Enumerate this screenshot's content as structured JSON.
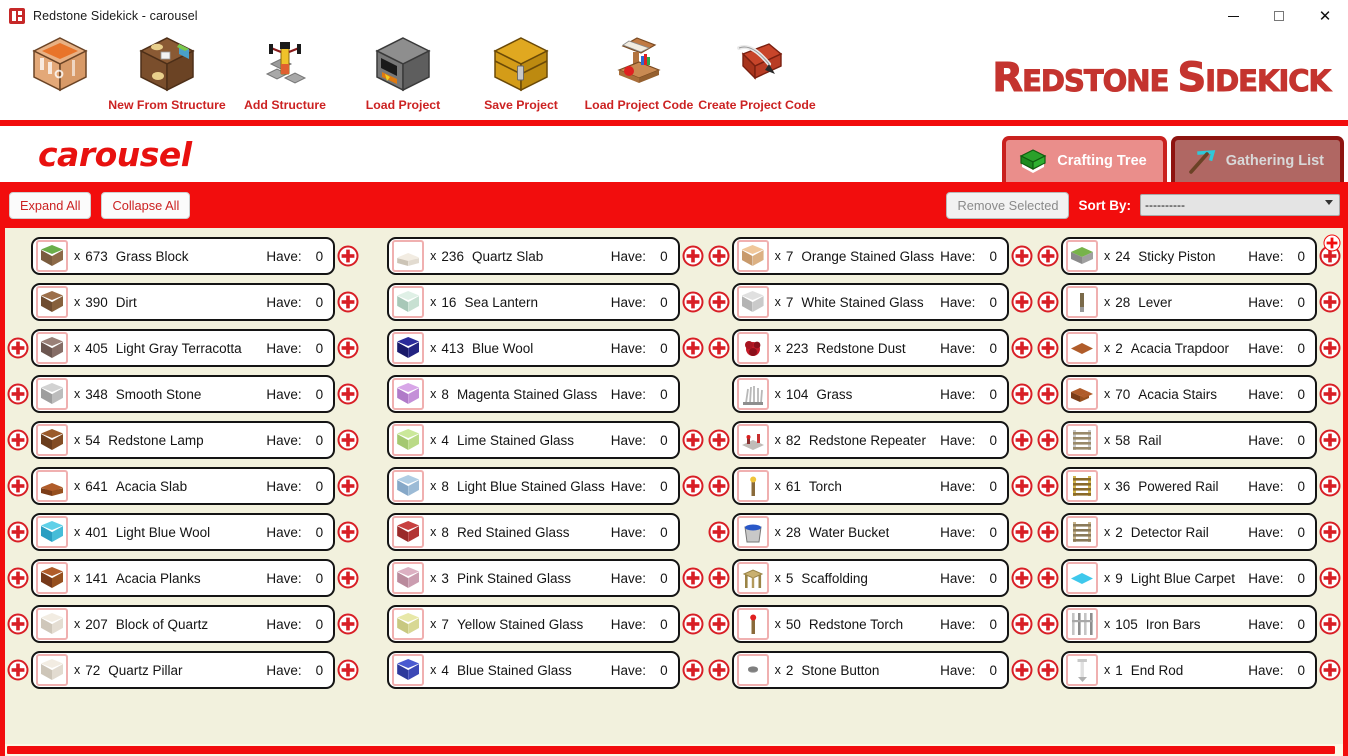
{
  "window": {
    "title": "Redstone Sidekick - carousel",
    "app_icon": "app-logo-icon",
    "minimize": "–",
    "maximize": "□",
    "close": "✕"
  },
  "brand": {
    "logo_primary": "R",
    "logo_rest1": "EDSTONE ",
    "logo_primary2": "S",
    "logo_rest2": "IDEKICK",
    "color": "#c4342f"
  },
  "toolbar": {
    "items": [
      {
        "label": "",
        "icon": "crafting-table-icon"
      },
      {
        "label": "New From Structure",
        "icon": "structure-block-icon"
      },
      {
        "label": "Add Structure",
        "icon": "redstone-torch-stand-icon"
      },
      {
        "label": "Load Project",
        "icon": "furnace-icon"
      },
      {
        "label": "Save Project",
        "icon": "chest-icon"
      },
      {
        "label": "Load Project Code",
        "icon": "lectern-icon"
      },
      {
        "label": "Create Project Code",
        "icon": "book-and-quill-icon"
      }
    ]
  },
  "project": {
    "name": "carousel"
  },
  "tabs": [
    {
      "label": "Crafting Tree",
      "icon": "green-book-icon",
      "active": true
    },
    {
      "label": "Gathering List",
      "icon": "pickaxe-icon",
      "active": false
    }
  ],
  "actions": {
    "expand_all": "Expand All",
    "collapse_all": "Collapse All",
    "remove_selected": "Remove Selected",
    "remove_selected_disabled": true,
    "sort_by_label": "Sort By:",
    "sort_by_value": "----------",
    "sort_by_options": [
      "----------"
    ]
  },
  "list": {
    "have_label": "Have:",
    "multiplier": "x",
    "columns": [
      {
        "rows": [
          {
            "qty": "673",
            "name": "Grass Block",
            "have": "0",
            "icon": "grass-block-icon",
            "left_plus": false,
            "right_plus": true,
            "colors": [
              "#6aae4a",
              "#7a5c3e",
              "#8d6a48"
            ]
          },
          {
            "qty": "390",
            "name": "Dirt",
            "have": "0",
            "icon": "dirt-icon",
            "left_plus": false,
            "right_plus": true,
            "colors": [
              "#9c6f4a",
              "#6f4c30",
              "#87603c"
            ]
          },
          {
            "qty": "405",
            "name": "Light Gray Terracotta",
            "have": "0",
            "icon": "light-gray-terracotta-icon",
            "left_plus": true,
            "right_plus": true,
            "colors": [
              "#9a8078",
              "#6c5650",
              "#866d66"
            ]
          },
          {
            "qty": "348",
            "name": "Smooth Stone",
            "have": "0",
            "icon": "smooth-stone-icon",
            "left_plus": true,
            "right_plus": true,
            "colors": [
              "#d2d2d2",
              "#9e9e9e",
              "#bcbcbc"
            ]
          },
          {
            "qty": "54",
            "name": "Redstone Lamp",
            "have": "0",
            "icon": "redstone-lamp-icon",
            "left_plus": true,
            "right_plus": true,
            "colors": [
              "#9a5a2a",
              "#6a3c1c",
              "#834c24"
            ]
          },
          {
            "qty": "641",
            "name": "Acacia Slab",
            "have": "0",
            "icon": "acacia-slab-icon",
            "left_plus": true,
            "right_plus": true,
            "colors": [
              "#b05c2a",
              "#7b3d18",
              "#96501f"
            ],
            "shape": "slab"
          },
          {
            "qty": "401",
            "name": "Light Blue Wool",
            "have": "0",
            "icon": "light-blue-wool-icon",
            "left_plus": true,
            "right_plus": true,
            "colors": [
              "#5fd0e8",
              "#2a9ec2",
              "#46bcd8"
            ]
          },
          {
            "qty": "141",
            "name": "Acacia Planks",
            "have": "0",
            "icon": "acacia-planks-icon",
            "left_plus": true,
            "right_plus": true,
            "colors": [
              "#b05c2a",
              "#76391a",
              "#96501f"
            ]
          },
          {
            "qty": "207",
            "name": "Block of Quartz",
            "have": "0",
            "icon": "block-of-quartz-icon",
            "left_plus": true,
            "right_plus": true,
            "colors": [
              "#f2ece2",
              "#cfc7ba",
              "#e4ddd2"
            ]
          },
          {
            "qty": "72",
            "name": "Quartz Pillar",
            "have": "0",
            "icon": "quartz-pillar-icon",
            "left_plus": true,
            "right_plus": true,
            "colors": [
              "#f2ece2",
              "#cdc5b8",
              "#e2dbd0"
            ]
          }
        ]
      },
      {
        "rows": [
          {
            "qty": "236",
            "name": "Quartz Slab",
            "have": "0",
            "icon": "quartz-slab-icon",
            "left_plus": false,
            "right_plus": true,
            "colors": [
              "#f2ece2",
              "#ccc4b6",
              "#e2dbd0"
            ],
            "shape": "slab"
          },
          {
            "qty": "16",
            "name": "Sea Lantern",
            "have": "0",
            "icon": "sea-lantern-icon",
            "left_plus": false,
            "right_plus": true,
            "colors": [
              "#dff0e6",
              "#a8c8b8",
              "#c7e0d2"
            ]
          },
          {
            "qty": "413",
            "name": "Blue Wool",
            "have": "0",
            "icon": "blue-wool-icon",
            "left_plus": false,
            "right_plus": true,
            "colors": [
              "#2a2a9a",
              "#1a1a6a",
              "#232382"
            ]
          },
          {
            "qty": "8",
            "name": "Magenta Stained Glass",
            "have": "0",
            "icon": "magenta-stained-glass-icon",
            "left_plus": false,
            "right_plus": false,
            "colors": [
              "#d8a6e8",
              "#b07ac8",
              "#c48fd8"
            ]
          },
          {
            "qty": "4",
            "name": "Lime Stained Glass",
            "have": "0",
            "icon": "lime-stained-glass-icon",
            "left_plus": false,
            "right_plus": true,
            "colors": [
              "#cbe89a",
              "#a4c870",
              "#bada86"
            ]
          },
          {
            "qty": "8",
            "name": "Light Blue Stained Glass",
            "have": "0",
            "icon": "light-blue-stained-glass-icon",
            "left_plus": false,
            "right_plus": true,
            "colors": [
              "#b0cde4",
              "#86a8c8",
              "#9cbbd6"
            ]
          },
          {
            "qty": "8",
            "name": "Red Stained Glass",
            "have": "0",
            "icon": "red-stained-glass-icon",
            "left_plus": false,
            "right_plus": false,
            "colors": [
              "#c84040",
              "#9a2a2a",
              "#b23535"
            ]
          },
          {
            "qty": "3",
            "name": "Pink Stained Glass",
            "have": "0",
            "icon": "pink-stained-glass-icon",
            "left_plus": false,
            "right_plus": true,
            "colors": [
              "#dcb0c2",
              "#b98a9c",
              "#cb9db0"
            ]
          },
          {
            "qty": "7",
            "name": "Yellow Stained Glass",
            "have": "0",
            "icon": "yellow-stained-glass-icon",
            "left_plus": false,
            "right_plus": true,
            "colors": [
              "#e8e8a8",
              "#c8c880",
              "#d8d894"
            ]
          },
          {
            "qty": "4",
            "name": "Blue Stained Glass",
            "have": "0",
            "icon": "blue-stained-glass-icon",
            "left_plus": false,
            "right_plus": true,
            "colors": [
              "#4a5ad0",
              "#2e3a9c",
              "#3c48b6"
            ]
          }
        ]
      },
      {
        "rows": [
          {
            "qty": "7",
            "name": "Orange Stained Glass",
            "have": "0",
            "icon": "orange-stained-glass-icon",
            "left_plus": true,
            "right_plus": true,
            "colors": [
              "#f0c79a",
              "#c89a6c",
              "#dcb183"
            ]
          },
          {
            "qty": "7",
            "name": "White Stained Glass",
            "have": "0",
            "icon": "white-stained-glass-icon",
            "left_plus": true,
            "right_plus": true,
            "colors": [
              "#e0e0e0",
              "#b4b4b4",
              "#cacaca"
            ]
          },
          {
            "qty": "223",
            "name": "Redstone Dust",
            "have": "0",
            "icon": "redstone-dust-icon",
            "left_plus": true,
            "right_plus": true,
            "colors": [
              "#c41a28",
              "#8a0f1a",
              "#a81521"
            ],
            "shape": "dust"
          },
          {
            "qty": "104",
            "name": "Grass",
            "have": "0",
            "icon": "grass-tuft-icon",
            "left_plus": false,
            "right_plus": true,
            "colors": [
              "#b8b8b8",
              "#8e8e8e",
              "#a6a6a6"
            ],
            "shape": "tuft"
          },
          {
            "qty": "82",
            "name": "Redstone Repeater",
            "have": "0",
            "icon": "redstone-repeater-icon",
            "left_plus": true,
            "right_plus": true,
            "colors": [
              "#c0bcb8",
              "#8d8884",
              "#a9a5a1"
            ],
            "shape": "repeater"
          },
          {
            "qty": "61",
            "name": "Torch",
            "have": "0",
            "icon": "torch-icon",
            "left_plus": true,
            "right_plus": true,
            "colors": [
              "#8a6a3a",
              "#6a4a24",
              "#f0c43a"
            ],
            "shape": "torch"
          },
          {
            "qty": "28",
            "name": "Water Bucket",
            "have": "0",
            "icon": "water-bucket-icon",
            "left_plus": true,
            "right_plus": true,
            "colors": [
              "#c8c8c8",
              "#9a9a9a",
              "#2a58c8"
            ],
            "shape": "bucket"
          },
          {
            "qty": "5",
            "name": "Scaffolding",
            "have": "0",
            "icon": "scaffolding-icon",
            "left_plus": true,
            "right_plus": true,
            "colors": [
              "#c9b070",
              "#9a8446",
              "#b39a5c"
            ],
            "shape": "scaffold"
          },
          {
            "qty": "50",
            "name": "Redstone Torch",
            "have": "0",
            "icon": "redstone-torch-icon",
            "left_plus": true,
            "right_plus": true,
            "colors": [
              "#8a6a3a",
              "#6a4a24",
              "#e02020"
            ],
            "shape": "torch"
          },
          {
            "qty": "2",
            "name": "Stone Button",
            "have": "0",
            "icon": "stone-button-icon",
            "left_plus": true,
            "right_plus": true,
            "colors": [
              "#8e8e8e",
              "#6e6e6e",
              "#7e7e7e"
            ],
            "shape": "button"
          }
        ]
      },
      {
        "rows": [
          {
            "qty": "24",
            "name": "Sticky Piston",
            "have": "0",
            "icon": "sticky-piston-icon",
            "left_plus": true,
            "right_plus": true,
            "colors": [
              "#77b34a",
              "#8a8a8a",
              "#a0a0a0"
            ],
            "shape": "piston"
          },
          {
            "qty": "28",
            "name": "Lever",
            "have": "0",
            "icon": "lever-icon",
            "left_plus": true,
            "right_plus": true,
            "colors": [
              "#9a9a9a",
              "#7a6a4a",
              "#8d7a56"
            ],
            "shape": "lever"
          },
          {
            "qty": "2",
            "name": "Acacia Trapdoor",
            "have": "0",
            "icon": "acacia-trapdoor-icon",
            "left_plus": true,
            "right_plus": true,
            "colors": [
              "#b05c2a",
              "#7b3d18",
              "#96501f"
            ],
            "shape": "flat"
          },
          {
            "qty": "70",
            "name": "Acacia Stairs",
            "have": "0",
            "icon": "acacia-stairs-icon",
            "left_plus": true,
            "right_plus": true,
            "colors": [
              "#b05c2a",
              "#7b3d18",
              "#96501f"
            ],
            "shape": "stairs"
          },
          {
            "qty": "58",
            "name": "Rail",
            "have": "0",
            "icon": "rail-icon",
            "left_plus": true,
            "right_plus": true,
            "colors": [
              "#c8c8c8",
              "#9a8a6a",
              "#b0a080"
            ],
            "shape": "rail"
          },
          {
            "qty": "36",
            "name": "Powered Rail",
            "have": "0",
            "icon": "powered-rail-icon",
            "left_plus": true,
            "right_plus": true,
            "colors": [
              "#d0b44a",
              "#8a6a2a",
              "#b08a30"
            ],
            "shape": "rail"
          },
          {
            "qty": "2",
            "name": "Detector Rail",
            "have": "0",
            "icon": "detector-rail-icon",
            "left_plus": true,
            "right_plus": true,
            "colors": [
              "#c8b48a",
              "#8a7a5a",
              "#a89470"
            ],
            "shape": "rail"
          },
          {
            "qty": "9",
            "name": "Light Blue Carpet",
            "have": "0",
            "icon": "light-blue-carpet-icon",
            "left_plus": true,
            "right_plus": true,
            "colors": [
              "#3ec8ec",
              "#2aa8cc",
              "#34b8dc"
            ],
            "shape": "carpet"
          },
          {
            "qty": "105",
            "name": "Iron Bars",
            "have": "0",
            "icon": "iron-bars-icon",
            "left_plus": true,
            "right_plus": true,
            "colors": [
              "#c4c4c4",
              "#8e8e8e",
              "#a8a8a8"
            ],
            "shape": "bars"
          },
          {
            "qty": "1",
            "name": "End Rod",
            "have": "0",
            "icon": "end-rod-icon",
            "left_plus": true,
            "right_plus": true,
            "colors": [
              "#e0e0e0",
              "#b0b0b0",
              "#c8c8c8"
            ],
            "shape": "rod"
          }
        ]
      }
    ]
  },
  "scroll": {
    "right_indicator": "scroll-right-icon",
    "horizontal_thumb": "h-scrollbar-thumb"
  }
}
